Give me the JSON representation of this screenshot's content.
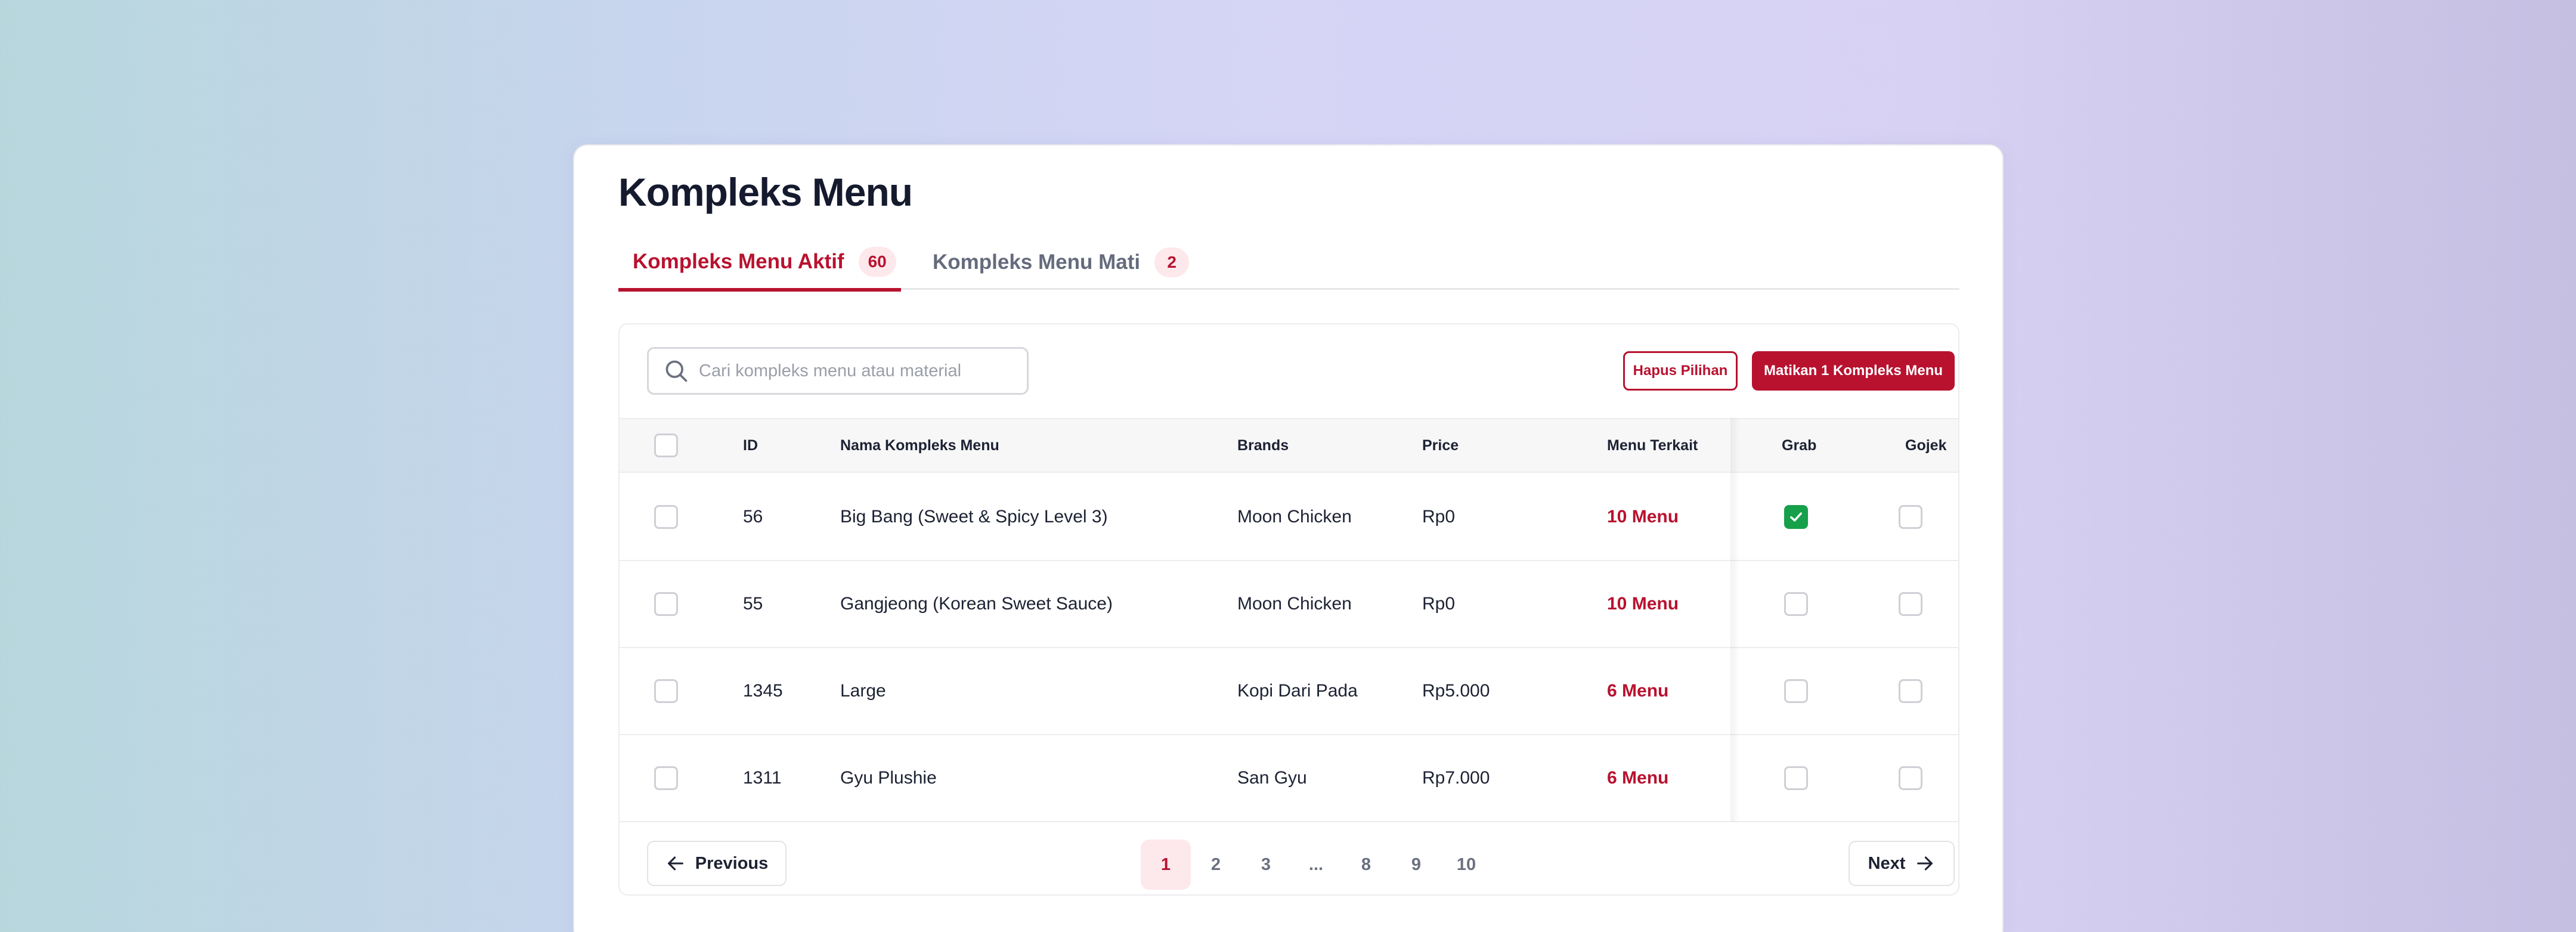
{
  "page": {
    "title": "Kompleks Menu"
  },
  "tabs": [
    {
      "label": "Kompleks Menu Aktif",
      "count": "60",
      "active": true
    },
    {
      "label": "Kompleks Menu Mati",
      "count": "2",
      "active": false
    }
  ],
  "toolbar": {
    "search_placeholder": "Cari kompleks menu atau material",
    "search_value": "",
    "clear_label": "Hapus Pilihan",
    "deactivate_label": "Matikan 1 Kompleks Menu"
  },
  "table": {
    "columns": {
      "id": "ID",
      "name": "Nama Kompleks Menu",
      "brand": "Brands",
      "price": "Price",
      "menu": "Menu Terkait",
      "grab": "Grab",
      "gojek": "Gojek"
    },
    "rows": [
      {
        "id": "56",
        "name": "Big Bang (Sweet & Spicy Level 3)",
        "brand": "Moon Chicken",
        "price": "Rp0",
        "menu": "10 Menu",
        "selected": false,
        "grab": true,
        "gojek": false
      },
      {
        "id": "55",
        "name": "Gangjeong (Korean Sweet Sauce)",
        "brand": "Moon Chicken",
        "price": "Rp0",
        "menu": "10 Menu",
        "selected": false,
        "grab": false,
        "gojek": false
      },
      {
        "id": "1345",
        "name": "Large",
        "brand": "Kopi Dari Pada",
        "price": "Rp5.000",
        "menu": "6 Menu",
        "selected": false,
        "grab": false,
        "gojek": false
      },
      {
        "id": "1311",
        "name": "Gyu Plushie",
        "brand": "San Gyu",
        "price": "Rp7.000",
        "menu": "6 Menu",
        "selected": false,
        "grab": false,
        "gojek": false
      }
    ]
  },
  "pagination": {
    "previous_label": "Previous",
    "next_label": "Next",
    "pages": [
      "1",
      "2",
      "3",
      "...",
      "8",
      "9",
      "10"
    ],
    "current": "1"
  },
  "colors": {
    "accent": "#b8122f",
    "accent_soft": "#fde8ec",
    "check_green": "#17a04a",
    "text_dark": "#151a2e"
  },
  "icons": {
    "search": "search-icon",
    "previous": "arrow-left-icon",
    "next": "arrow-right-icon",
    "check": "checkmark-icon"
  }
}
